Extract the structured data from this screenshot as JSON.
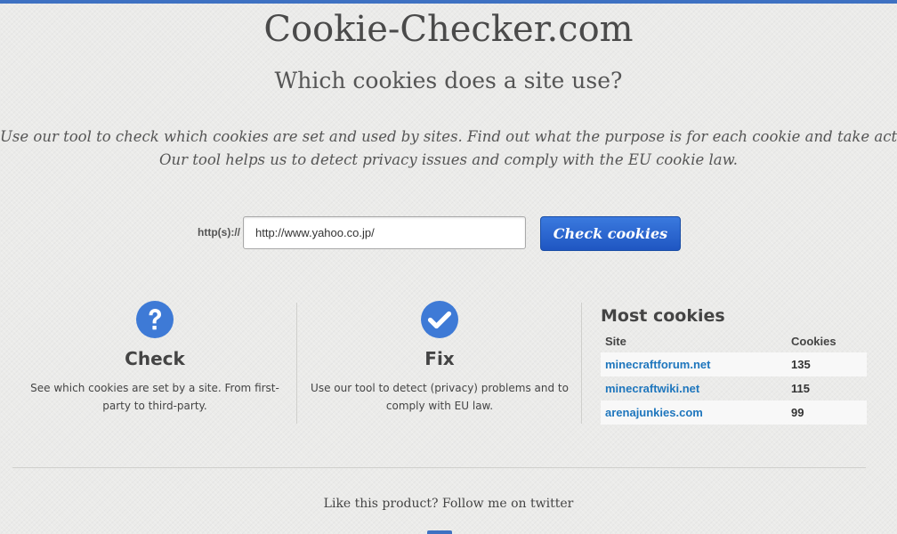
{
  "header": {
    "title": "Cookie-Checker.com",
    "subtitle": "Which cookies does a site use?"
  },
  "intro": {
    "line1": "Use our tool to check which cookies are set and used by sites. Find out what the purpose is for each cookie and take action.",
    "line2": "Our tool helps us to detect privacy issues and comply with the EU cookie law."
  },
  "search": {
    "label": "http(s)://",
    "value": "http://www.yahoo.co.jp/",
    "button_label": "Check cookies"
  },
  "features": [
    {
      "icon": "question-circle-icon",
      "heading": "Check",
      "line1": "See which cookies are set by a site. From first-",
      "line2": "party to third-party."
    },
    {
      "icon": "check-circle-icon",
      "heading": "Fix",
      "line1": "Use our tool to detect (privacy) problems and to",
      "line2": "comply with EU law."
    }
  ],
  "most_cookies": {
    "title": "Most cookies",
    "columns": [
      "Site",
      "Cookies"
    ],
    "rows": [
      {
        "site": "minecraftforum.net",
        "count": "135"
      },
      {
        "site": "minecraftwiki.net",
        "count": "115"
      },
      {
        "site": "arenajunkies.com",
        "count": "99"
      }
    ]
  },
  "footer": {
    "text": "Like this product? Follow me on twitter"
  },
  "colors": {
    "accent": "#3e71c2",
    "button": "#1f56c2",
    "link": "#1e76bd",
    "background": "#ebebe9"
  }
}
